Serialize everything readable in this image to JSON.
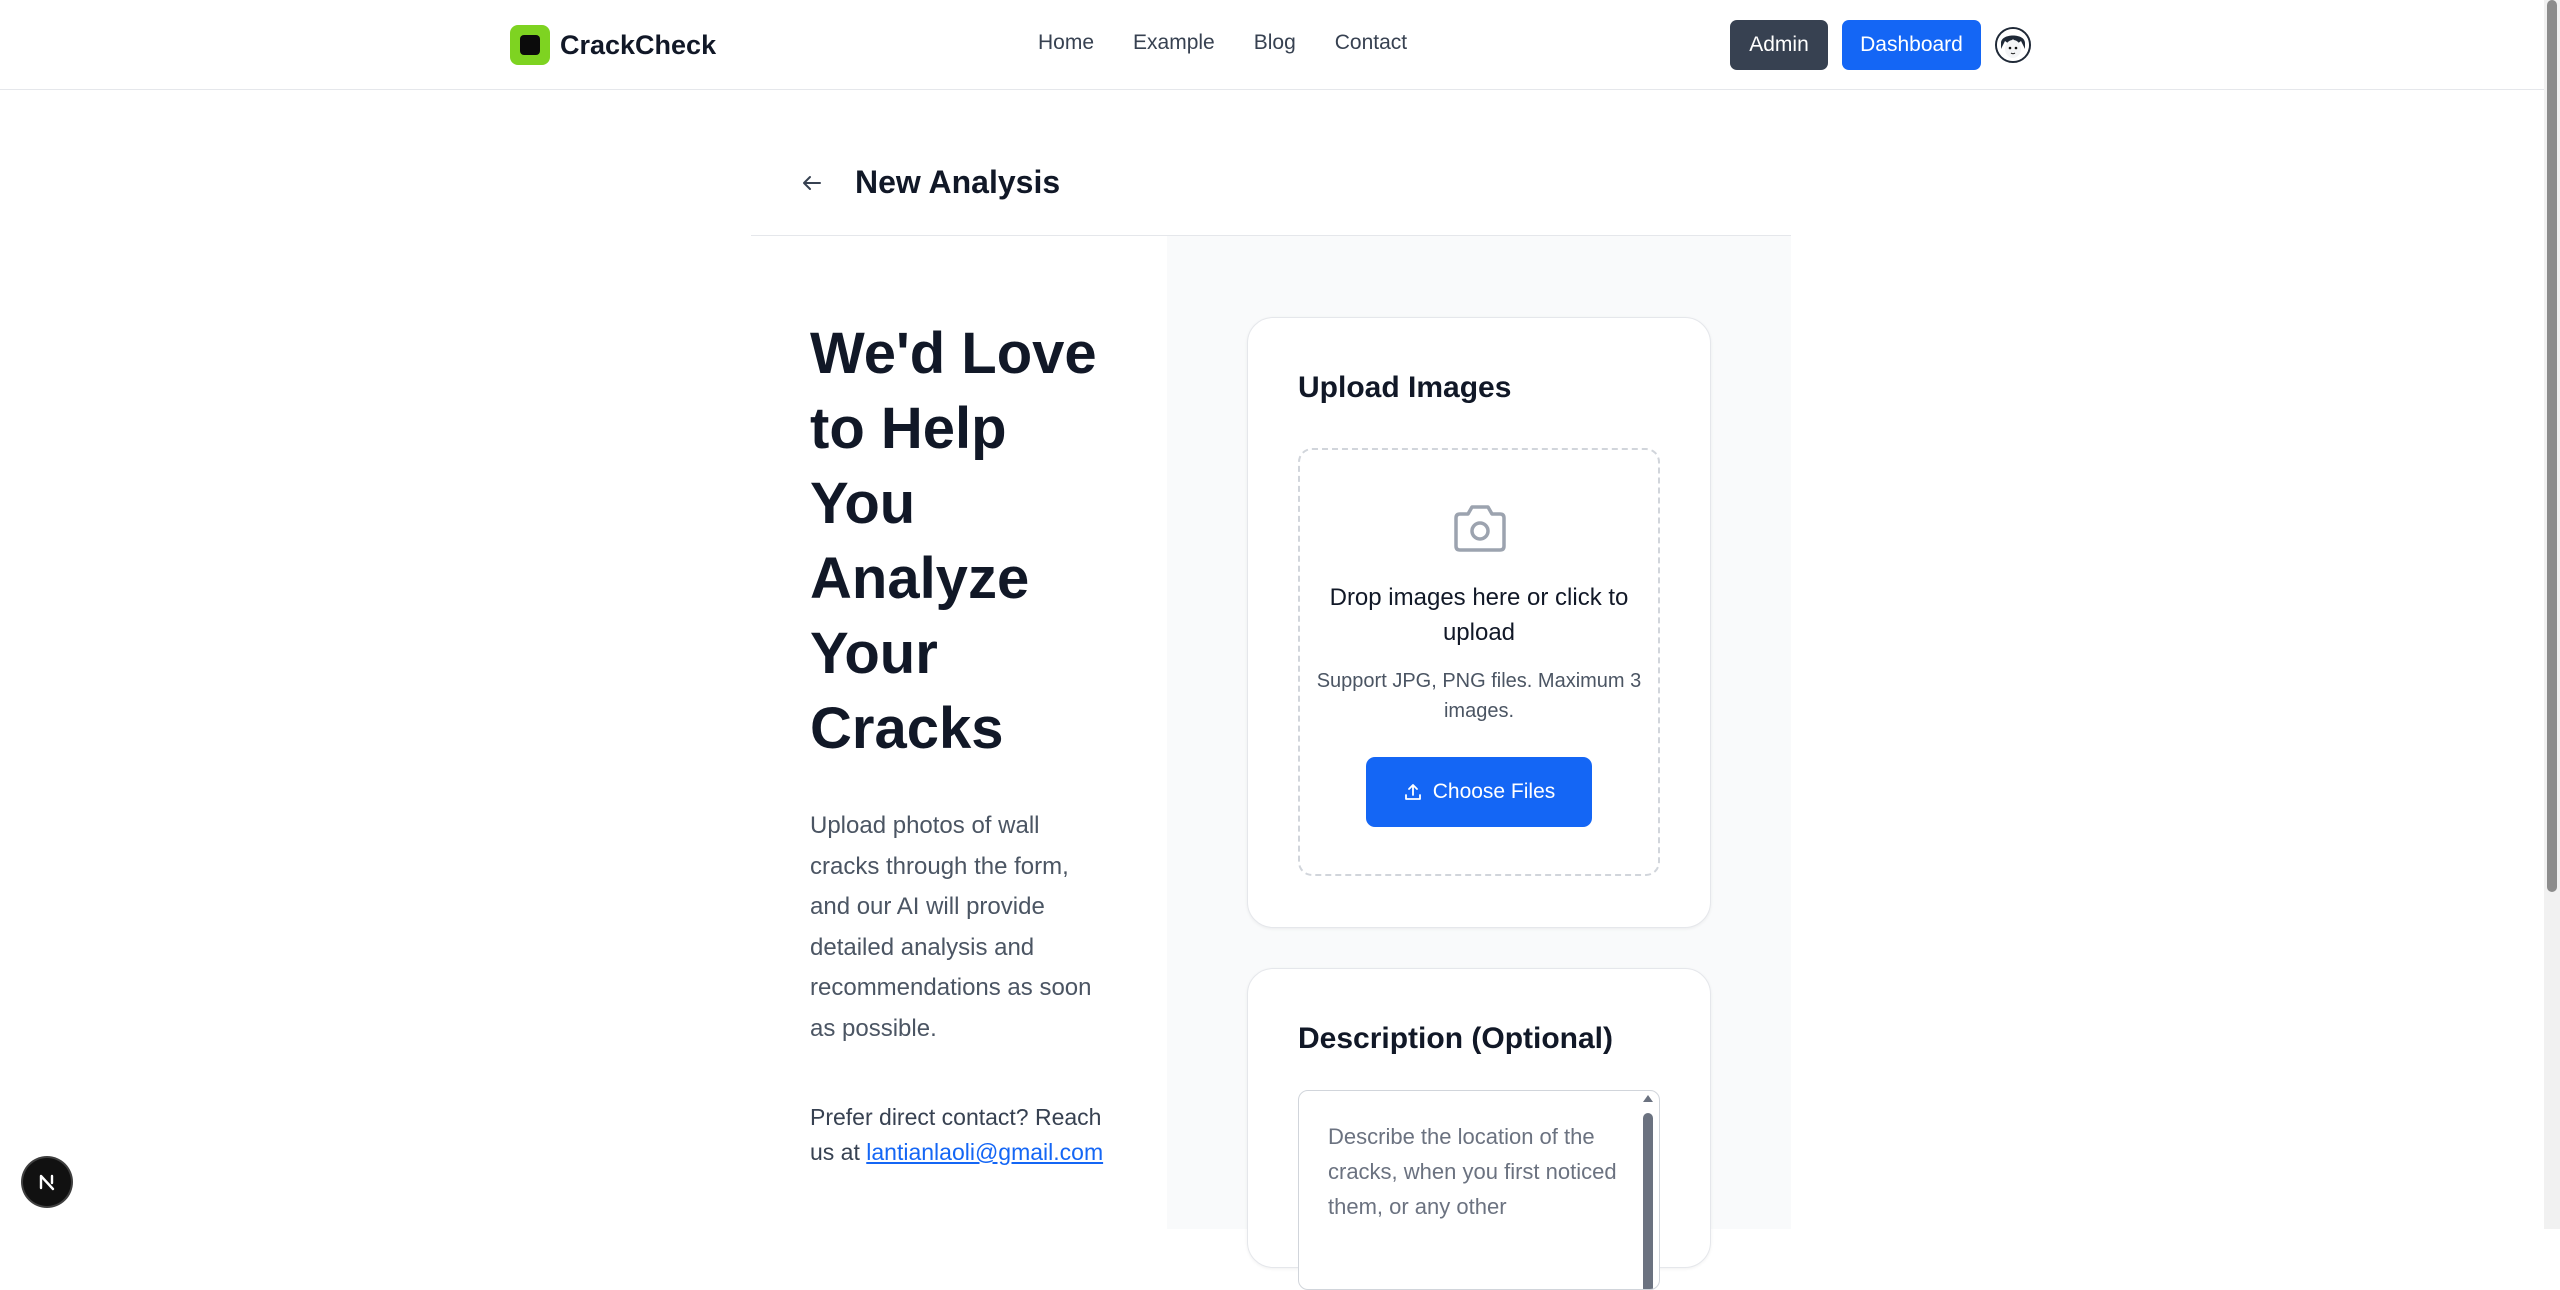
{
  "header": {
    "logo_text": "CrackCheck",
    "nav": [
      "Home",
      "Example",
      "Blog",
      "Contact"
    ],
    "admin_label": "Admin",
    "dashboard_label": "Dashboard"
  },
  "page": {
    "title": "New Analysis"
  },
  "hero": {
    "heading": "We'd Love to Help You Analyze Your Cracks",
    "intro": "Upload photos of wall cracks through the form, and our AI will provide detailed analysis and recommendations as soon as possible.",
    "contact_prefix": "Prefer direct contact? Reach us at ",
    "contact_email": "lantianlaoli@gmail.com"
  },
  "upload": {
    "title": "Upload Images",
    "drop_text": "Drop images here or click to upload",
    "hint": "Support JPG, PNG files. Maximum 3 images.",
    "button_label": "Choose Files"
  },
  "description": {
    "title": "Description (Optional)",
    "placeholder": "Describe the location of the cracks, when you first noticed them, or any other"
  },
  "dev_badge": {
    "label": "N"
  },
  "colors": {
    "brand_green": "#7ed321",
    "primary_blue": "#1466f5",
    "admin_dark": "#374151"
  }
}
